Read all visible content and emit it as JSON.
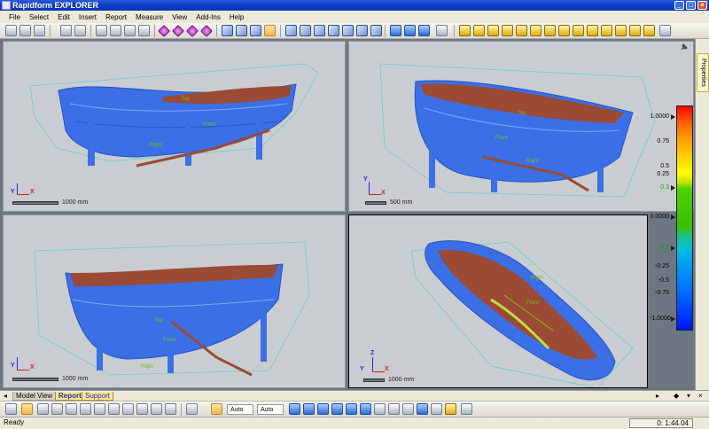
{
  "window": {
    "title": "Rapidform EXPLORER"
  },
  "menu": [
    "File",
    "Select",
    "Edit",
    "Insert",
    "Report",
    "Measure",
    "View",
    "Add-Ins",
    "Help"
  ],
  "viewports": {
    "top_left": {
      "scale": "1000 mm",
      "labels": [
        "Front",
        "Right",
        "Top"
      ]
    },
    "top_right": {
      "scale": "500 mm",
      "labels": [
        "Front",
        "Right",
        "Top"
      ]
    },
    "bottom_left": {
      "scale": "1000 mm",
      "labels": [
        "Top",
        "Front",
        "Right"
      ]
    },
    "bottom_right": {
      "scale": "1000 mm",
      "labels": [
        "Right",
        "Front"
      ]
    }
  },
  "legend": {
    "ticks": [
      "1.0000",
      "0.75",
      "0.5",
      "0.25",
      "0.3",
      "0.0000",
      "-0.3",
      "-0.25",
      "-0.5",
      "-0.75",
      "-1.0000"
    ]
  },
  "properties_tab": "Properties",
  "tabs": [
    "Model View",
    "Report",
    "Support"
  ],
  "toolbar2": {
    "dropdown1": "Auto",
    "dropdown2": "Auto"
  },
  "status": {
    "text": "Ready",
    "timer": "0: 1:44.04"
  },
  "colors": {
    "mesh_blue": "#3b6fe6",
    "mesh_interior": "#9b4a35",
    "title_blue": "#0a3cc7"
  }
}
